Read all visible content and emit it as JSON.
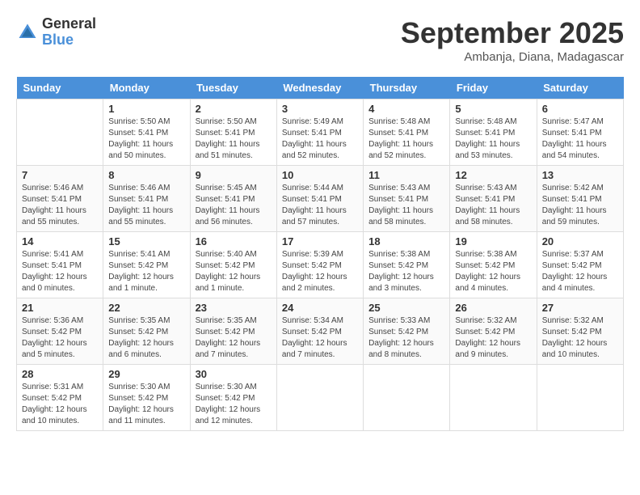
{
  "logo": {
    "general": "General",
    "blue": "Blue"
  },
  "title": {
    "month": "September 2025",
    "location": "Ambanja, Diana, Madagascar"
  },
  "headers": [
    "Sunday",
    "Monday",
    "Tuesday",
    "Wednesday",
    "Thursday",
    "Friday",
    "Saturday"
  ],
  "weeks": [
    [
      {
        "day": "",
        "sunrise": "",
        "sunset": "",
        "daylight": ""
      },
      {
        "day": "1",
        "sunrise": "Sunrise: 5:50 AM",
        "sunset": "Sunset: 5:41 PM",
        "daylight": "Daylight: 11 hours and 50 minutes."
      },
      {
        "day": "2",
        "sunrise": "Sunrise: 5:50 AM",
        "sunset": "Sunset: 5:41 PM",
        "daylight": "Daylight: 11 hours and 51 minutes."
      },
      {
        "day": "3",
        "sunrise": "Sunrise: 5:49 AM",
        "sunset": "Sunset: 5:41 PM",
        "daylight": "Daylight: 11 hours and 52 minutes."
      },
      {
        "day": "4",
        "sunrise": "Sunrise: 5:48 AM",
        "sunset": "Sunset: 5:41 PM",
        "daylight": "Daylight: 11 hours and 52 minutes."
      },
      {
        "day": "5",
        "sunrise": "Sunrise: 5:48 AM",
        "sunset": "Sunset: 5:41 PM",
        "daylight": "Daylight: 11 hours and 53 minutes."
      },
      {
        "day": "6",
        "sunrise": "Sunrise: 5:47 AM",
        "sunset": "Sunset: 5:41 PM",
        "daylight": "Daylight: 11 hours and 54 minutes."
      }
    ],
    [
      {
        "day": "7",
        "sunrise": "Sunrise: 5:46 AM",
        "sunset": "Sunset: 5:41 PM",
        "daylight": "Daylight: 11 hours and 55 minutes."
      },
      {
        "day": "8",
        "sunrise": "Sunrise: 5:46 AM",
        "sunset": "Sunset: 5:41 PM",
        "daylight": "Daylight: 11 hours and 55 minutes."
      },
      {
        "day": "9",
        "sunrise": "Sunrise: 5:45 AM",
        "sunset": "Sunset: 5:41 PM",
        "daylight": "Daylight: 11 hours and 56 minutes."
      },
      {
        "day": "10",
        "sunrise": "Sunrise: 5:44 AM",
        "sunset": "Sunset: 5:41 PM",
        "daylight": "Daylight: 11 hours and 57 minutes."
      },
      {
        "day": "11",
        "sunrise": "Sunrise: 5:43 AM",
        "sunset": "Sunset: 5:41 PM",
        "daylight": "Daylight: 11 hours and 58 minutes."
      },
      {
        "day": "12",
        "sunrise": "Sunrise: 5:43 AM",
        "sunset": "Sunset: 5:41 PM",
        "daylight": "Daylight: 11 hours and 58 minutes."
      },
      {
        "day": "13",
        "sunrise": "Sunrise: 5:42 AM",
        "sunset": "Sunset: 5:41 PM",
        "daylight": "Daylight: 11 hours and 59 minutes."
      }
    ],
    [
      {
        "day": "14",
        "sunrise": "Sunrise: 5:41 AM",
        "sunset": "Sunset: 5:41 PM",
        "daylight": "Daylight: 12 hours and 0 minutes."
      },
      {
        "day": "15",
        "sunrise": "Sunrise: 5:41 AM",
        "sunset": "Sunset: 5:42 PM",
        "daylight": "Daylight: 12 hours and 1 minute."
      },
      {
        "day": "16",
        "sunrise": "Sunrise: 5:40 AM",
        "sunset": "Sunset: 5:42 PM",
        "daylight": "Daylight: 12 hours and 1 minute."
      },
      {
        "day": "17",
        "sunrise": "Sunrise: 5:39 AM",
        "sunset": "Sunset: 5:42 PM",
        "daylight": "Daylight: 12 hours and 2 minutes."
      },
      {
        "day": "18",
        "sunrise": "Sunrise: 5:38 AM",
        "sunset": "Sunset: 5:42 PM",
        "daylight": "Daylight: 12 hours and 3 minutes."
      },
      {
        "day": "19",
        "sunrise": "Sunrise: 5:38 AM",
        "sunset": "Sunset: 5:42 PM",
        "daylight": "Daylight: 12 hours and 4 minutes."
      },
      {
        "day": "20",
        "sunrise": "Sunrise: 5:37 AM",
        "sunset": "Sunset: 5:42 PM",
        "daylight": "Daylight: 12 hours and 4 minutes."
      }
    ],
    [
      {
        "day": "21",
        "sunrise": "Sunrise: 5:36 AM",
        "sunset": "Sunset: 5:42 PM",
        "daylight": "Daylight: 12 hours and 5 minutes."
      },
      {
        "day": "22",
        "sunrise": "Sunrise: 5:35 AM",
        "sunset": "Sunset: 5:42 PM",
        "daylight": "Daylight: 12 hours and 6 minutes."
      },
      {
        "day": "23",
        "sunrise": "Sunrise: 5:35 AM",
        "sunset": "Sunset: 5:42 PM",
        "daylight": "Daylight: 12 hours and 7 minutes."
      },
      {
        "day": "24",
        "sunrise": "Sunrise: 5:34 AM",
        "sunset": "Sunset: 5:42 PM",
        "daylight": "Daylight: 12 hours and 7 minutes."
      },
      {
        "day": "25",
        "sunrise": "Sunrise: 5:33 AM",
        "sunset": "Sunset: 5:42 PM",
        "daylight": "Daylight: 12 hours and 8 minutes."
      },
      {
        "day": "26",
        "sunrise": "Sunrise: 5:32 AM",
        "sunset": "Sunset: 5:42 PM",
        "daylight": "Daylight: 12 hours and 9 minutes."
      },
      {
        "day": "27",
        "sunrise": "Sunrise: 5:32 AM",
        "sunset": "Sunset: 5:42 PM",
        "daylight": "Daylight: 12 hours and 10 minutes."
      }
    ],
    [
      {
        "day": "28",
        "sunrise": "Sunrise: 5:31 AM",
        "sunset": "Sunset: 5:42 PM",
        "daylight": "Daylight: 12 hours and 10 minutes."
      },
      {
        "day": "29",
        "sunrise": "Sunrise: 5:30 AM",
        "sunset": "Sunset: 5:42 PM",
        "daylight": "Daylight: 12 hours and 11 minutes."
      },
      {
        "day": "30",
        "sunrise": "Sunrise: 5:30 AM",
        "sunset": "Sunset: 5:42 PM",
        "daylight": "Daylight: 12 hours and 12 minutes."
      },
      {
        "day": "",
        "sunrise": "",
        "sunset": "",
        "daylight": ""
      },
      {
        "day": "",
        "sunrise": "",
        "sunset": "",
        "daylight": ""
      },
      {
        "day": "",
        "sunrise": "",
        "sunset": "",
        "daylight": ""
      },
      {
        "day": "",
        "sunrise": "",
        "sunset": "",
        "daylight": ""
      }
    ]
  ]
}
